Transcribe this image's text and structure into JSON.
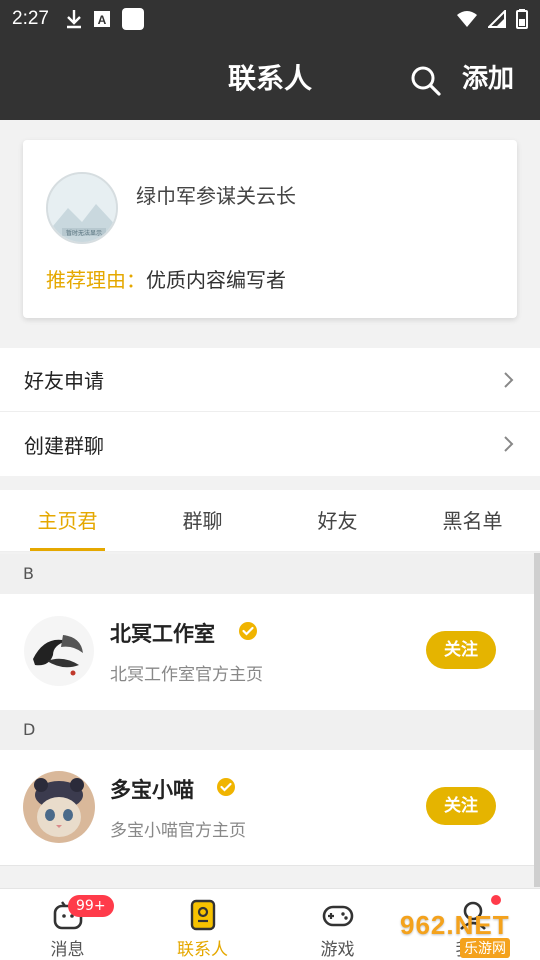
{
  "status_bar": {
    "time": "2:27"
  },
  "header": {
    "title": "联系人",
    "add_label": "添加"
  },
  "recommend": {
    "avatar_text": "暂时无法显示",
    "name": "绿巾军参谋关云长",
    "reason_label": "推荐理由：",
    "reason_value": "优质内容编写者"
  },
  "menu": [
    {
      "label": "好友申请"
    },
    {
      "label": "创建群聊"
    }
  ],
  "tabs": [
    {
      "label": "主页君",
      "active": true
    },
    {
      "label": "群聊",
      "active": false
    },
    {
      "label": "好友",
      "active": false
    },
    {
      "label": "黑名单",
      "active": false
    }
  ],
  "sections": [
    {
      "letter": "B",
      "contact": {
        "name": "北冥工作室",
        "desc": "北冥工作室官方主页",
        "follow_label": "关注"
      }
    },
    {
      "letter": "D",
      "contact": {
        "name": "多宝小喵",
        "desc": "多宝小喵官方主页",
        "follow_label": "关注"
      }
    }
  ],
  "bottom_nav": [
    {
      "label": "消息",
      "badge": "99+",
      "icon": "message-icon"
    },
    {
      "label": "联系人",
      "active": true,
      "icon": "contacts-icon"
    },
    {
      "label": "游戏",
      "icon": "gamepad-icon"
    },
    {
      "label": "我的",
      "icon": "profile-icon"
    }
  ],
  "watermark": {
    "logo": "962.NET",
    "sub": "乐游网"
  },
  "colors": {
    "accent": "#e5a800",
    "header_bg": "#333333",
    "badge": "#ff3b4a"
  }
}
